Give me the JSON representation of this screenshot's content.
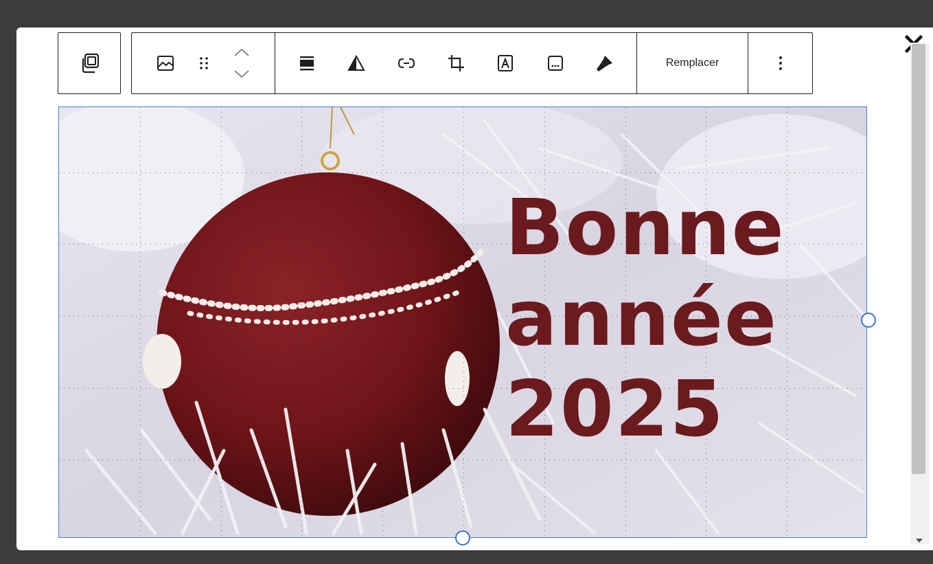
{
  "toolbar": {
    "duplicate_icon": "duplicate-icon",
    "image_icon": "image-icon",
    "drag_icon": "drag-handle-icon",
    "move_icon": "move-up-down-icon",
    "align_icon": "align-icon",
    "duotone_icon": "duotone-filter-icon",
    "link_icon": "link-icon",
    "crop_icon": "crop-icon",
    "text_overlay_icon": "text-overlay-icon",
    "caption_icon": "caption-icon",
    "styles_icon": "paintbrush-icon",
    "replace_label": "Remplacer",
    "more_icon": "more-options-icon"
  },
  "close_icon": "close-icon",
  "image": {
    "line1": "Bonne",
    "line2": "année",
    "line3": "2025",
    "text_color": "#6b1a1e",
    "ornament_color": "#6e1418"
  },
  "selection_color": "#3b74c9"
}
